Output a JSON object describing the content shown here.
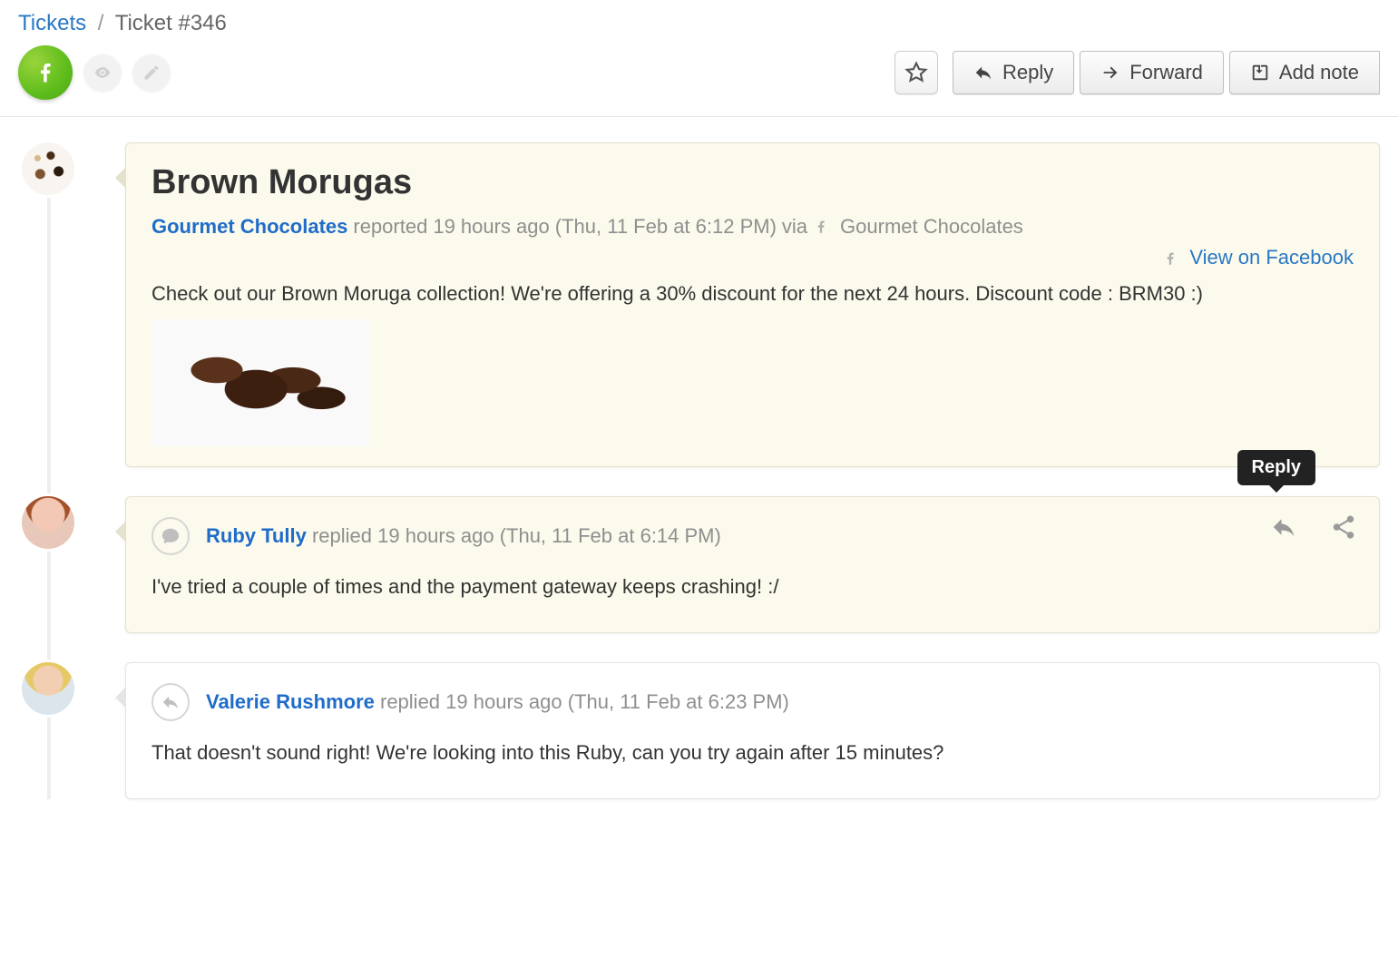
{
  "breadcrumb": {
    "root": "Tickets",
    "current": "Ticket #346"
  },
  "toolbar": {
    "reply": "Reply",
    "forward": "Forward",
    "add_note": "Add note"
  },
  "ticket": {
    "title": "Brown Morugas",
    "author": "Gourmet Chocolates",
    "reported_action": "reported",
    "reported_ago": "19 hours ago",
    "reported_timestamp": "(Thu, 11 Feb at 6:12 PM)",
    "via_label": "via",
    "via_source": "Gourmet Chocolates",
    "view_on_fb": "View on Facebook",
    "body": "Check out our Brown Moruga collection! We're offering a 30% discount for the next 24 hours. Discount code : BRM30 :)"
  },
  "replies": [
    {
      "author": "Ruby Tully",
      "action": "replied",
      "ago": "19 hours ago",
      "timestamp": "(Thu, 11 Feb at 6:14 PM)",
      "body": "I've tried a couple of times and the payment gateway keeps crashing! :/",
      "highlight": true
    },
    {
      "author": "Valerie Rushmore",
      "action": "replied",
      "ago": "19 hours ago",
      "timestamp": "(Thu, 11 Feb at 6:23 PM)",
      "body": "That doesn't sound right! We're looking into this Ruby, can you try again after 15 minutes?",
      "highlight": false
    }
  ],
  "tooltip": {
    "reply": "Reply"
  }
}
